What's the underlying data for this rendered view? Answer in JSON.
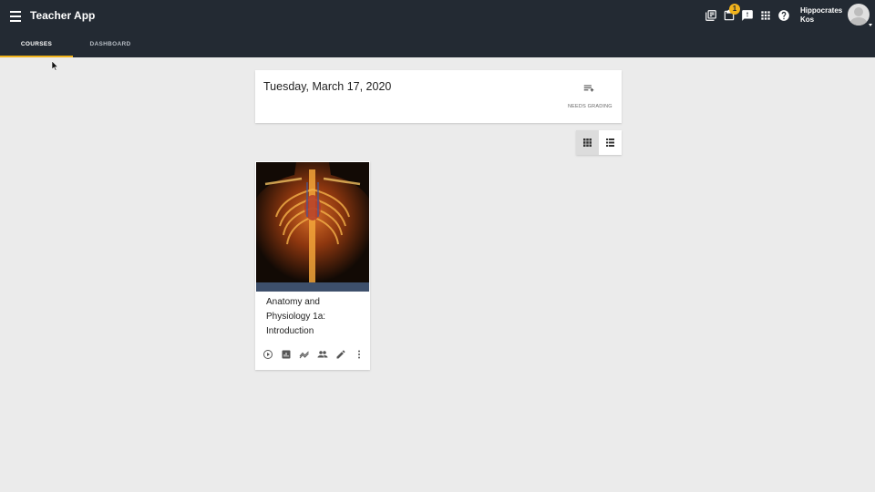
{
  "app": {
    "title": "Teacher App"
  },
  "header": {
    "notification_count": "1",
    "user_name": "Hippocrates Kos",
    "icons": [
      "library-books-icon",
      "clipboard-icon",
      "feedback-icon",
      "apps-grid-icon",
      "help-icon"
    ]
  },
  "tabs": [
    {
      "label": "COURSES",
      "active": true
    },
    {
      "label": "DASHBOARD",
      "active": false
    }
  ],
  "date_card": {
    "date": "Tuesday, March 17, 2020",
    "needs_grading_label": "NEEDS GRADING"
  },
  "view_toggle": {
    "selected": "grid"
  },
  "courses": [
    {
      "title": "Anatomy and Physiology 1a: Introduction",
      "actions": [
        "play-icon",
        "gradebook-icon",
        "progress-icon",
        "students-icon",
        "edit-icon",
        "more-icon"
      ]
    }
  ],
  "colors": {
    "topbar": "#232a33",
    "accent": "#f1b31c",
    "page_bg": "#ebebeb"
  }
}
